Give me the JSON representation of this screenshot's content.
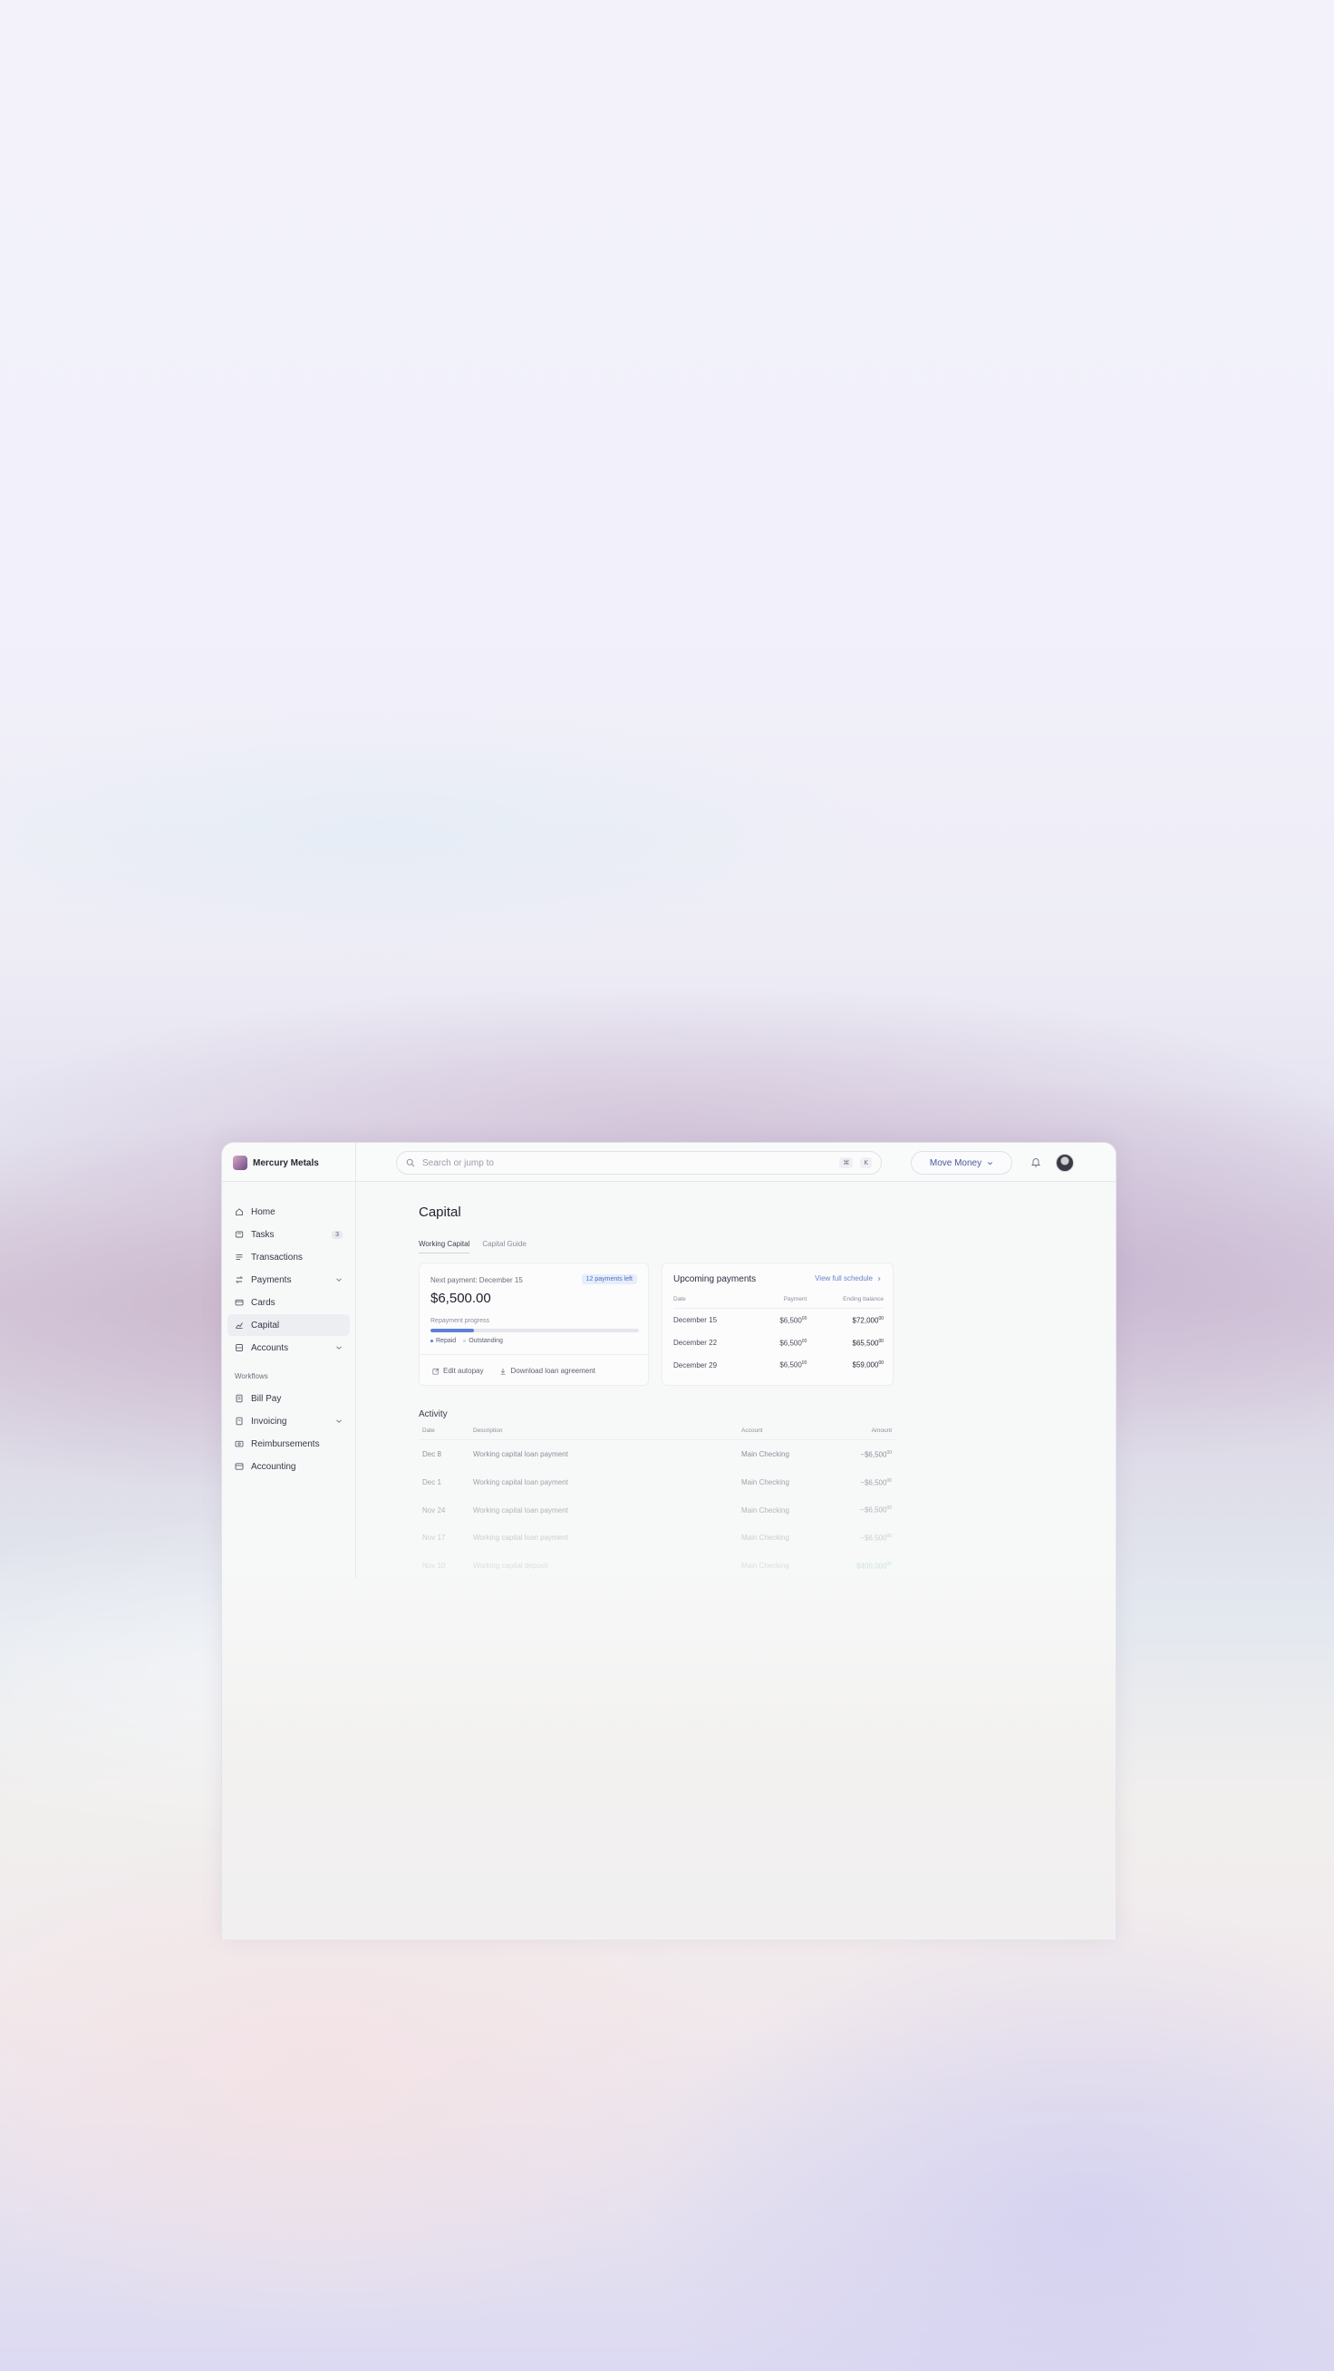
{
  "app": {
    "brand": "Mercury Metals",
    "search_placeholder": "Search or jump to",
    "search_shortcut": [
      "⌘",
      "K"
    ],
    "move_money_label": "Move Money"
  },
  "sidebar": {
    "items": [
      {
        "label": "Home",
        "icon": "home-icon"
      },
      {
        "label": "Tasks",
        "icon": "tasks-icon",
        "badge": "3"
      },
      {
        "label": "Transactions",
        "icon": "transactions-icon"
      },
      {
        "label": "Payments",
        "icon": "payments-icon",
        "expandable": true
      },
      {
        "label": "Cards",
        "icon": "card-icon"
      },
      {
        "label": "Capital",
        "icon": "capital-icon",
        "active": true
      },
      {
        "label": "Accounts",
        "icon": "accounts-icon",
        "expandable": true
      }
    ],
    "workflows_heading": "Workflows",
    "workflows": [
      {
        "label": "Bill Pay",
        "icon": "bill-pay-icon"
      },
      {
        "label": "Invoicing",
        "icon": "invoicing-icon",
        "expandable": true
      },
      {
        "label": "Reimbursements",
        "icon": "reimbursements-icon"
      },
      {
        "label": "Accounting",
        "icon": "accounting-icon"
      }
    ]
  },
  "page": {
    "title": "Capital",
    "tabs": [
      "Working Capital",
      "Capital Guide"
    ],
    "active_tab": 0
  },
  "next_payment": {
    "label": "Next payment: December 15",
    "payments_left": "12 payments left",
    "amount": "$6,500.00",
    "progress_label": "Repayment progress",
    "progress_fraction": 0.21,
    "legend_repaid": "Repaid",
    "legend_outstanding": "Outstanding",
    "edit_autopay": "Edit autopay",
    "download_agreement": "Download loan agreement"
  },
  "upcoming": {
    "title": "Upcoming payments",
    "view_link": "View full schedule",
    "columns": [
      "Date",
      "Payment",
      "Ending balance"
    ],
    "rows": [
      {
        "date": "December 15",
        "payment": "$6,500",
        "payment_cents": "00",
        "balance": "$72,000",
        "balance_cents": "00"
      },
      {
        "date": "December 22",
        "payment": "$6,500",
        "payment_cents": "00",
        "balance": "$65,500",
        "balance_cents": "00"
      },
      {
        "date": "December 29",
        "payment": "$6,500",
        "payment_cents": "00",
        "balance": "$59,000",
        "balance_cents": "00"
      }
    ]
  },
  "activity": {
    "title": "Activity",
    "columns": [
      "Date",
      "Description",
      "Account",
      "Amount"
    ],
    "rows": [
      {
        "date": "Dec 8",
        "description": "Working capital loan payment",
        "account": "Main Checking",
        "amount": "−$6,500",
        "cents": "00"
      },
      {
        "date": "Dec 1",
        "description": "Working capital loan payment",
        "account": "Main Checking",
        "amount": "−$6,500",
        "cents": "00"
      },
      {
        "date": "Nov 24",
        "description": "Working capital loan payment",
        "account": "Main Checking",
        "amount": "−$6,500",
        "cents": "00"
      },
      {
        "date": "Nov 17",
        "description": "Working capital loan payment",
        "account": "Main Checking",
        "amount": "−$6,500",
        "cents": "00"
      },
      {
        "date": "Nov 10",
        "description": "Working capital deposit",
        "account": "Main Checking",
        "amount": "$400,000",
        "cents": "00",
        "positive": true
      }
    ]
  },
  "colors": {
    "accent": "#5f7fd8",
    "link": "#6a84c8",
    "positive": "#3b9a63"
  }
}
